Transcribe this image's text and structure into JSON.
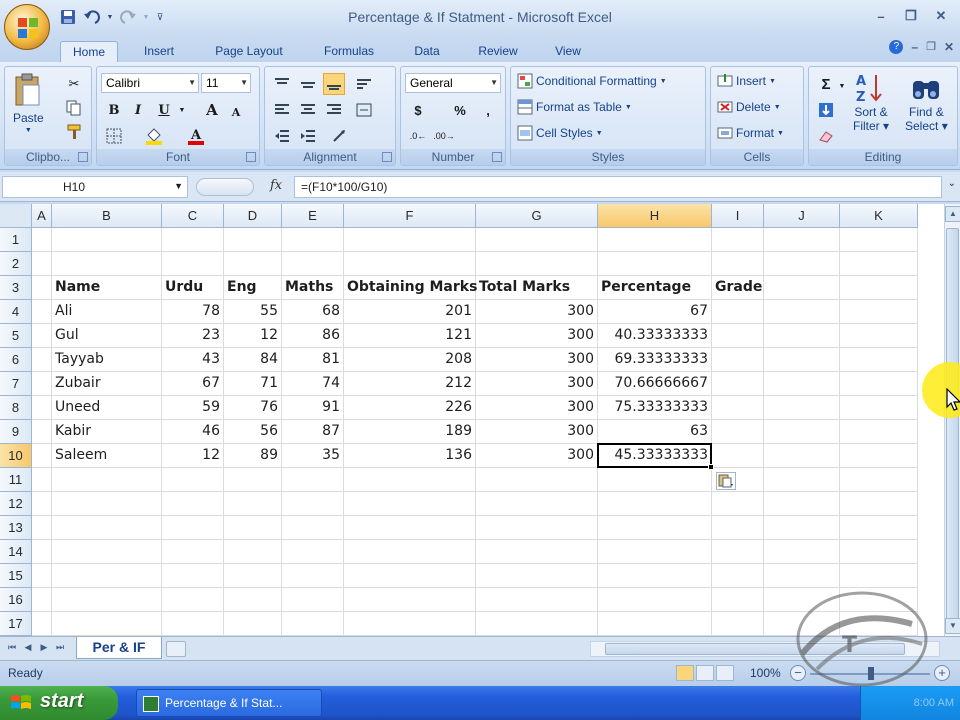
{
  "window": {
    "title": "Percentage & If Statment - Microsoft Excel",
    "minimize": "–",
    "restore": "❐",
    "close": "✕"
  },
  "ribbon": {
    "tabs": [
      "Home",
      "Insert",
      "Page Layout",
      "Formulas",
      "Data",
      "Review",
      "View"
    ],
    "active_tab": "Home",
    "clipboard": {
      "paste": "Paste",
      "label": "Clipbo..."
    },
    "font": {
      "name": "Calibri",
      "size": "11",
      "label": "Font",
      "bold": "B",
      "italic": "I",
      "underline": "U",
      "grow": "A",
      "shrink": "A"
    },
    "alignment": {
      "label": "Alignment"
    },
    "number": {
      "format": "General",
      "currency": "$",
      "percent": "%",
      "comma": ",",
      "label": "Number"
    },
    "styles": {
      "conditional": "Conditional Formatting",
      "table": "Format as Table",
      "cell_styles": "Cell Styles",
      "label": "Styles"
    },
    "cells": {
      "insert": "Insert",
      "delete": "Delete",
      "format": "Format",
      "label": "Cells"
    },
    "editing": {
      "sigma": "Σ",
      "sort": "Sort &",
      "sort2": "Filter",
      "find": "Find &",
      "find2": "Select",
      "label": "Editing"
    }
  },
  "formula_bar": {
    "name_box": "H10",
    "fx": "fx",
    "formula": "=(F10*100/G10)"
  },
  "sheet": {
    "columns": [
      "A",
      "B",
      "C",
      "D",
      "E",
      "F",
      "G",
      "H",
      "I",
      "J",
      "K"
    ],
    "selected_column": "H",
    "rows": [
      "1",
      "2",
      "3",
      "4",
      "5",
      "6",
      "7",
      "8",
      "9",
      "10",
      "11",
      "12",
      "13",
      "14",
      "15",
      "16",
      "17"
    ],
    "selected_row": "10",
    "headers": [
      "Name",
      "Urdu",
      "Eng",
      "Maths",
      "Obtaining Marks",
      "Total Marks",
      "Percentage",
      "Grade"
    ],
    "data": [
      [
        "Ali",
        "78",
        "55",
        "68",
        "201",
        "300",
        "67"
      ],
      [
        "Gul",
        "23",
        "12",
        "86",
        "121",
        "300",
        "40.33333333"
      ],
      [
        "Tayyab",
        "43",
        "84",
        "81",
        "208",
        "300",
        "69.33333333"
      ],
      [
        "Zubair",
        "67",
        "71",
        "74",
        "212",
        "300",
        "70.66666667"
      ],
      [
        "Uneed",
        "59",
        "76",
        "91",
        "226",
        "300",
        "75.33333333"
      ],
      [
        "Kabir",
        "46",
        "56",
        "87",
        "189",
        "300",
        "63"
      ],
      [
        "Saleem",
        "12",
        "89",
        "35",
        "136",
        "300",
        "45.33333333"
      ]
    ]
  },
  "sheet_tabs": {
    "active": "Per & IF"
  },
  "status": {
    "text": "Ready",
    "zoom": "100%"
  },
  "taskbar": {
    "start": "start",
    "window": "Percentage & If Stat...",
    "clock": "8:00 AM"
  },
  "colors": {
    "accent": "#15428b",
    "selection": "#f7c86b",
    "taskbar": "#245edc",
    "start": "#3a9a3a"
  }
}
